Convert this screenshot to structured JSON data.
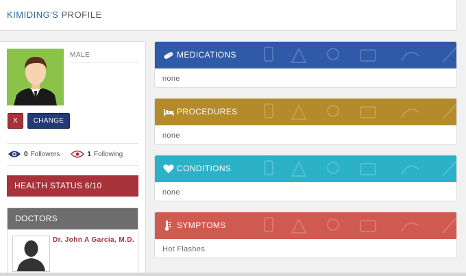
{
  "header": {
    "name": "KIMIDING'S",
    "title": "PROFILE"
  },
  "profile": {
    "gender": "MALE",
    "remove_label": "X",
    "change_label": "CHANGE",
    "followers_count": "0",
    "followers_label": "Followers",
    "following_count": "1",
    "following_label": "Following",
    "health_status": "HEALTH STATUS 6/10"
  },
  "doctors": {
    "heading": "DOCTORS",
    "items": [
      {
        "name": "Dr. John A Garcia, M.D."
      }
    ]
  },
  "cards": [
    {
      "title": "MEDICATIONS",
      "icon": "pill-icon",
      "value": "none",
      "color": "#2e5aa8"
    },
    {
      "title": "PROCEDURES",
      "icon": "bed-icon",
      "value": "none",
      "color": "#b58a2a"
    },
    {
      "title": "CONDITIONS",
      "icon": "heart-icon",
      "value": "none",
      "color": "#2bb2c8"
    },
    {
      "title": "SYMPTOMS",
      "icon": "thermometer-icon",
      "value": "Hot Flashes",
      "color": "#d05a50"
    }
  ]
}
